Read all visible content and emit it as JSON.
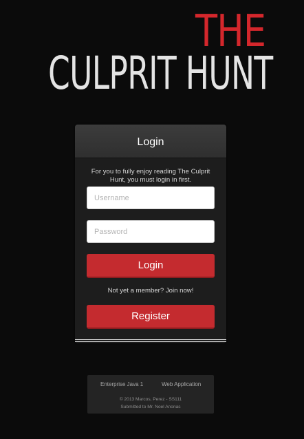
{
  "logo": {
    "top_word": "THE",
    "main_words": "CULPRIT HUNT"
  },
  "login": {
    "title": "Login",
    "intro": "For you to fully enjoy reading The Culprit Hunt, you must login in first.",
    "username_placeholder": "Username",
    "password_placeholder": "Password",
    "login_button": "Login",
    "join_text": "Not yet a member? Join now!",
    "register_button": "Register"
  },
  "footer": {
    "links": [
      "Enterprise Java 1",
      "Web Application"
    ],
    "copyright": "© 2013 Marcos, Perez - SS111",
    "submitted": "Submitted to Mr. Noel Anonas"
  },
  "colors": {
    "accent_red": "#c42b2f",
    "background": "#0b0b0b"
  }
}
